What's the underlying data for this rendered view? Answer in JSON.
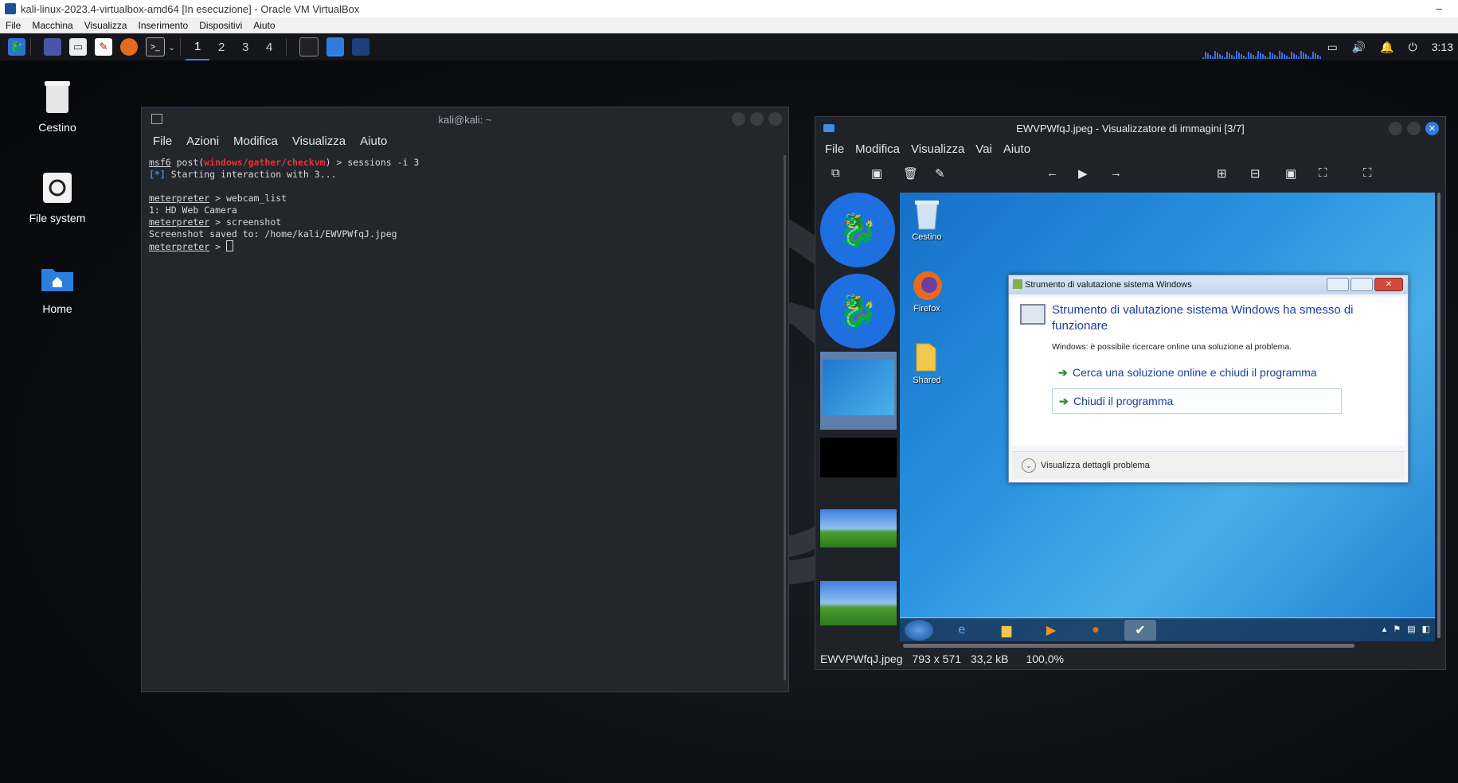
{
  "host": {
    "title": "kali-linux-2023.4-virtualbox-amd64 [In esecuzione] - Oracle VM VirtualBox",
    "menu": [
      "File",
      "Macchina",
      "Visualizza",
      "Inserimento",
      "Dispositivi",
      "Aiuto"
    ]
  },
  "panel": {
    "workspaces": [
      "1",
      "2",
      "3",
      "4"
    ],
    "active_workspace": "1",
    "clock": "3:13"
  },
  "desktop_icons": [
    {
      "label": "Cestino",
      "icon": "trash-icon"
    },
    {
      "label": "File system",
      "icon": "drive-icon"
    },
    {
      "label": "Home",
      "icon": "home-folder-icon"
    }
  ],
  "terminal": {
    "title": "kali@kali: ~",
    "menu": [
      "File",
      "Azioni",
      "Modifica",
      "Visualizza",
      "Aiuto"
    ],
    "lines": {
      "l1_prefix": "msf6",
      "l1_post": " post(",
      "l1_module": "windows/gather/checkvm",
      "l1_cmd": ") > sessions -i 3",
      "l2_tag": "[*]",
      "l2_text": " Starting interaction with 3...",
      "l3_prompt": "meterpreter",
      "l3_cmd": " > webcam_list",
      "l4_text": "1: HD Web Camera",
      "l5_prompt": "meterpreter",
      "l5_cmd": " > screenshot",
      "l6_text": "Screenshot saved to: /home/kali/EWVPWfqJ.jpeg",
      "l7_prompt": "meterpreter",
      "l7_cmd": " > "
    }
  },
  "viewer": {
    "title": "EWVPWfqJ.jpeg - Visualizzatore di immagini [3/7]",
    "menu": [
      "File",
      "Modifica",
      "Visualizza",
      "Vai",
      "Aiuto"
    ],
    "status": {
      "filename": "EWVPWfqJ.jpeg",
      "dimensions": "793 x 571",
      "size": "33,2 kB",
      "zoom": "100,0%"
    },
    "win7": {
      "icons": [
        "Cestino",
        "Firefox",
        "Shared"
      ],
      "dialog": {
        "title": "Strumento di valutazione sistema Windows",
        "heading": "Strumento di valutazione sistema Windows ha smesso di funzionare",
        "subtext": "Windows: è possibile ricercare online una soluzione al problema.",
        "option1": "Cerca una soluzione online e chiudi il programma",
        "option2": "Chiudi il programma",
        "details": "Visualizza dettagli problema"
      }
    }
  }
}
